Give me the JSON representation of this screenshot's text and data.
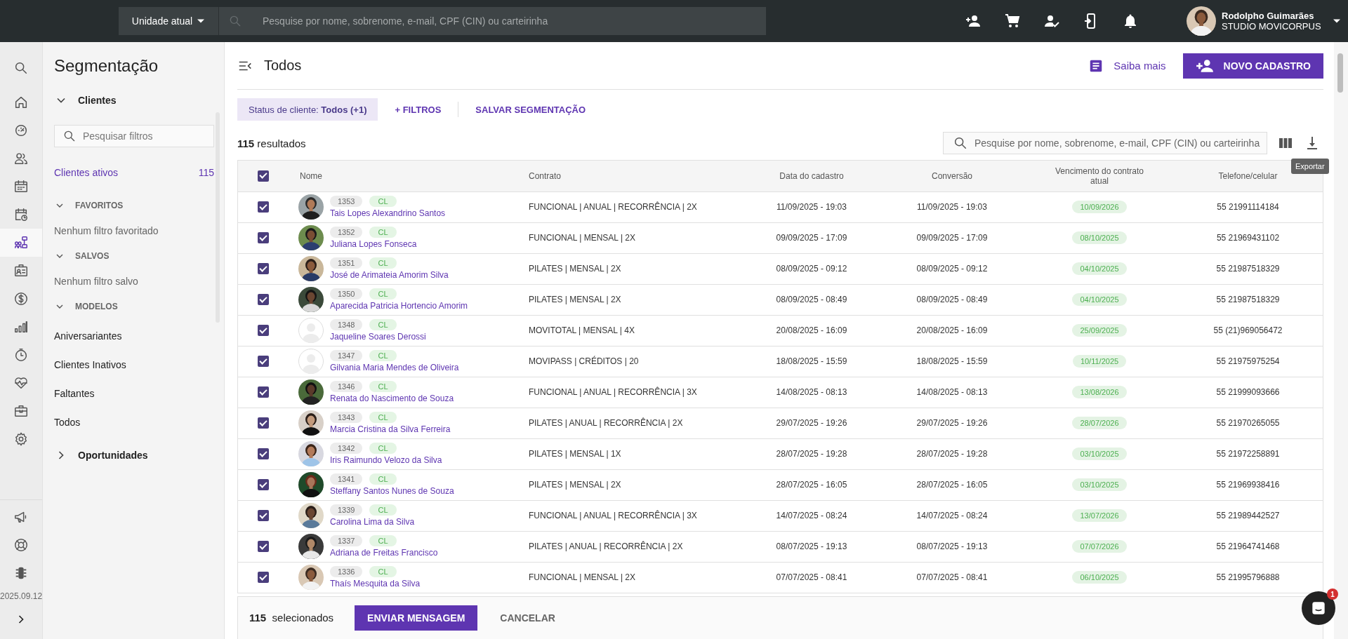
{
  "top_bar": {
    "unit_selector": "Unidade atual",
    "search": {
      "placeholder": "Pesquise por nome, sobrenome, e-mail, CPF (CIN) ou carteirinha"
    },
    "user": {
      "name": "Rodolpho Guimarães",
      "company": "STUDIO MOVICORPUS"
    }
  },
  "rail": {
    "items": [
      {
        "selected": false
      },
      {
        "selected": false
      },
      {
        "selected": false
      },
      {
        "selected": false
      },
      {
        "selected": false
      },
      {
        "selected": false
      },
      {
        "selected": true
      },
      {
        "selected": false
      },
      {
        "selected": false
      },
      {
        "selected": false
      },
      {
        "selected": false
      },
      {
        "selected": false
      },
      {
        "selected": false
      },
      {
        "selected": false
      }
    ],
    "version": "2025.09.12"
  },
  "sidebar": {
    "title": "Segmentação",
    "sections": [
      {
        "label": "Clientes",
        "expanded": true,
        "search_placeholder": "Pesquisar filtros",
        "items": [
          {
            "label": "Clientes ativos",
            "count": "115",
            "selected": true
          }
        ],
        "groups": [
          {
            "label": "FAVORITOS",
            "expanded": true,
            "empty_text": "Nenhum filtro favoritado"
          },
          {
            "label": "SALVOS",
            "expanded": true,
            "empty_text": "Nenhum filtro salvo"
          },
          {
            "label": "MODELOS",
            "expanded": true,
            "items": [
              {
                "label": "Aniversariantes",
                "selected": false
              },
              {
                "label": "Clientes Inativos",
                "selected": false
              },
              {
                "label": "Faltantes",
                "selected": false
              },
              {
                "label": "Todos",
                "selected": false
              }
            ]
          }
        ]
      },
      {
        "label": "Oportunidades",
        "expanded": false
      }
    ]
  },
  "page": {
    "title": "Todos",
    "help_link": "Saiba mais",
    "primary_button": "NOVO CADASTRO"
  },
  "filters": {
    "status_chip": {
      "label": "Status de cliente:",
      "value": "Todos (+1)"
    },
    "add_filter": "+ FILTROS",
    "save": "SALVAR SEGMENTAÇÃO"
  },
  "results": {
    "count": "115",
    "label": "resultados"
  },
  "table_search": {
    "placeholder": "Pesquise por nome, sobrenome, e-mail, CPF (CIN) ou carteirinha"
  },
  "export_tooltip": "Exportar",
  "table": {
    "all_checked": true,
    "columns": [
      "Nome",
      "Contrato",
      "Data do cadastro",
      "Conversão",
      "Vencimento do contrato atual",
      "Telefone/celular"
    ],
    "rows": [
      {
        "checked": true,
        "photo": true,
        "code": "1353",
        "tag": "CL",
        "name": "Tais Lopes Alexandrino Santos",
        "contract": "FUNCIONAL | ANUAL | RECORRÊNCIA | 2X",
        "registered": "11/09/2025 - 19:03",
        "conversion": "11/09/2025 - 19:03",
        "expiry": "10/09/2026",
        "phone": "55 21991114184"
      },
      {
        "checked": true,
        "photo": true,
        "code": "1352",
        "tag": "CL",
        "name": "Juliana Lopes Fonseca",
        "contract": "FUNCIONAL | MENSAL | 2X",
        "registered": "09/09/2025 - 17:09",
        "conversion": "09/09/2025 - 17:09",
        "expiry": "08/10/2025",
        "phone": "55 21969431102"
      },
      {
        "checked": true,
        "photo": true,
        "code": "1351",
        "tag": "CL",
        "name": "José de Arimateia Amorim Silva",
        "contract": "PILATES | MENSAL | 2X",
        "registered": "08/09/2025 - 09:12",
        "conversion": "08/09/2025 - 09:12",
        "expiry": "04/10/2025",
        "phone": "55 21987518329"
      },
      {
        "checked": true,
        "photo": true,
        "code": "1350",
        "tag": "CL",
        "name": "Aparecida Patricia Hortencio Amorim",
        "contract": "PILATES | MENSAL | 2X",
        "registered": "08/09/2025 - 08:49",
        "conversion": "08/09/2025 - 08:49",
        "expiry": "04/10/2025",
        "phone": "55 21987518329"
      },
      {
        "checked": true,
        "photo": false,
        "code": "1348",
        "tag": "CL",
        "name": "Jaqueline Soares Derossi",
        "contract": "MOVITOTAL | MENSAL | 4X",
        "registered": "20/08/2025 - 16:09",
        "conversion": "20/08/2025 - 16:09",
        "expiry": "25/09/2025",
        "phone": "55 (21)969056472"
      },
      {
        "checked": true,
        "photo": false,
        "code": "1347",
        "tag": "CL",
        "name": "Gilvania Maria Mendes de Oliveira",
        "contract": "MOVIPASS | CRÉDITOS | 20",
        "registered": "18/08/2025 - 15:59",
        "conversion": "18/08/2025 - 15:59",
        "expiry": "10/11/2025",
        "phone": "55 21975975254"
      },
      {
        "checked": true,
        "photo": true,
        "code": "1346",
        "tag": "CL",
        "name": "Renata do Nascimento de Souza",
        "contract": "FUNCIONAL | ANUAL | RECORRÊNCIA | 3X",
        "registered": "14/08/2025 - 08:13",
        "conversion": "14/08/2025 - 08:13",
        "expiry": "13/08/2026",
        "phone": "55 21999093666"
      },
      {
        "checked": true,
        "photo": true,
        "code": "1343",
        "tag": "CL",
        "name": "Marcia Cristina da Silva Ferreira",
        "contract": "PILATES | ANUAL | RECORRÊNCIA | 2X",
        "registered": "29/07/2025 - 19:26",
        "conversion": "29/07/2025 - 19:26",
        "expiry": "28/07/2026",
        "phone": "55 21970265055"
      },
      {
        "checked": true,
        "photo": true,
        "code": "1342",
        "tag": "CL",
        "name": "Iris Raimundo Velozo da Silva",
        "contract": "PILATES | MENSAL | 1X",
        "registered": "28/07/2025 - 19:28",
        "conversion": "28/07/2025 - 19:28",
        "expiry": "03/10/2025",
        "phone": "55 21972258891"
      },
      {
        "checked": true,
        "photo": true,
        "code": "1341",
        "tag": "CL",
        "name": "Steffany Santos Nunes de Souza",
        "contract": "PILATES | MENSAL | 2X",
        "registered": "28/07/2025 - 16:05",
        "conversion": "28/07/2025 - 16:05",
        "expiry": "03/10/2025",
        "phone": "55 21969938416"
      },
      {
        "checked": true,
        "photo": true,
        "code": "1339",
        "tag": "CL",
        "name": "Carolina Lima da Silva",
        "contract": "FUNCIONAL | ANUAL | RECORRÊNCIA | 3X",
        "registered": "14/07/2025 - 08:24",
        "conversion": "14/07/2025 - 08:24",
        "expiry": "13/07/2026",
        "phone": "55 21989442527"
      },
      {
        "checked": true,
        "photo": true,
        "code": "1337",
        "tag": "CL",
        "name": "Adriana de Freitas Francisco",
        "contract": "PILATES | ANUAL | RECORRÊNCIA | 2X",
        "registered": "08/07/2025 - 19:13",
        "conversion": "08/07/2025 - 19:13",
        "expiry": "07/07/2026",
        "phone": "55 21964741468"
      },
      {
        "checked": true,
        "photo": true,
        "code": "1336",
        "tag": "CL",
        "name": "Thaís Mesquita da Silva",
        "contract": "FUNCIONAL | MENSAL | 2X",
        "registered": "07/07/2025 - 08:41",
        "conversion": "07/07/2025 - 08:41",
        "expiry": "06/10/2025",
        "phone": "55 21995796888"
      }
    ]
  },
  "selection_bar": {
    "count": "115",
    "label": "selecionados",
    "send_button": "ENVIAR MENSAGEM",
    "cancel_button": "CANCELAR"
  },
  "chat": {
    "badge": "1"
  }
}
